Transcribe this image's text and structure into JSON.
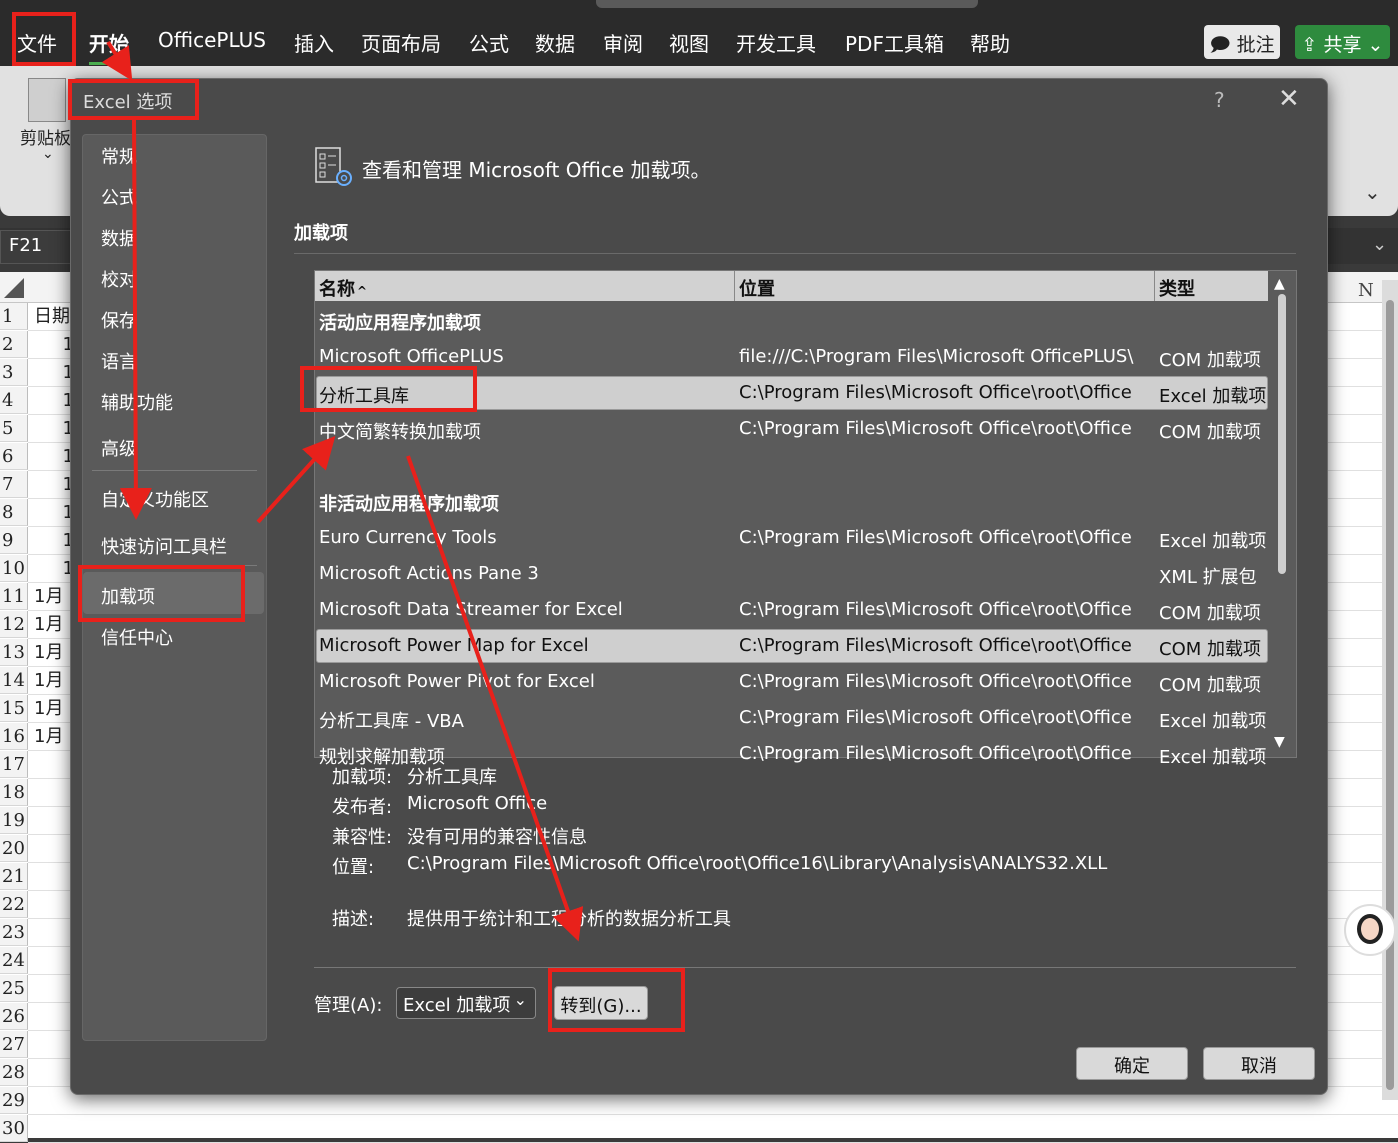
{
  "menu": {
    "items": [
      "文件",
      "开始",
      "OfficePLUS",
      "插入",
      "页面布局",
      "公式",
      "数据",
      "审阅",
      "视图",
      "开发工具",
      "PDF工具箱",
      "帮助"
    ],
    "active_index": 1,
    "comment_label": "批注",
    "share_label": "共享"
  },
  "ribbon": {
    "clipboard_label": "剪贴板"
  },
  "namebox": "F21",
  "sheet": {
    "row_numbers": [
      "1",
      "2",
      "3",
      "4",
      "5",
      "6",
      "7",
      "8",
      "9",
      "10",
      "11",
      "12",
      "13",
      "14",
      "15",
      "16",
      "17",
      "18",
      "19",
      "20",
      "21",
      "22",
      "23",
      "24",
      "25",
      "26",
      "27",
      "28",
      "29",
      "30"
    ],
    "col_a": [
      "日期",
      "1",
      "1",
      "1",
      "1",
      "1",
      "1",
      "1",
      "1",
      "1",
      "1月",
      "1月",
      "1月",
      "1月",
      "1月",
      "1月",
      "",
      "",
      "",
      "",
      "",
      "",
      "",
      "",
      "",
      "",
      "",
      "",
      "",
      ""
    ],
    "col_n": "N"
  },
  "dialog": {
    "title": "Excel 选项",
    "help": "?",
    "close": "✕",
    "nav": [
      "常规",
      "公式",
      "数据",
      "校对",
      "保存",
      "语言",
      "辅助功能",
      "高级",
      "自定义功能区",
      "快速访问工具栏",
      "加载项",
      "信任中心"
    ],
    "nav_selected": "加载项",
    "header_text": "查看和管理 Microsoft Office 加载项。",
    "section_label": "加载项",
    "table": {
      "columns": [
        "名称",
        "位置",
        "类型"
      ],
      "sort_marker": "^",
      "active_group": "活动应用程序加载项",
      "active_rows": [
        {
          "name": "Microsoft OfficePLUS",
          "location": "file:///C:\\Program Files\\Microsoft OfficePLUS\\",
          "type": "COM 加载项"
        },
        {
          "name": "分析工具库",
          "location": "C:\\Program Files\\Microsoft Office\\root\\Office",
          "type": "Excel 加载项"
        },
        {
          "name": "中文简繁转换加载项",
          "location": "C:\\Program Files\\Microsoft Office\\root\\Office",
          "type": "COM 加载项"
        }
      ],
      "inactive_group": "非活动应用程序加载项",
      "inactive_rows": [
        {
          "name": "Euro Currency Tools",
          "location": "C:\\Program Files\\Microsoft Office\\root\\Office",
          "type": "Excel 加载项"
        },
        {
          "name": "Microsoft Actions Pane 3",
          "location": "",
          "type": "XML 扩展包"
        },
        {
          "name": "Microsoft Data Streamer for Excel",
          "location": "C:\\Program Files\\Microsoft Office\\root\\Office",
          "type": "COM 加载项"
        },
        {
          "name": "Microsoft Power Map for Excel",
          "location": "C:\\Program Files\\Microsoft Office\\root\\Office",
          "type": "COM 加载项"
        },
        {
          "name": "Microsoft Power Pivot for Excel",
          "location": "C:\\Program Files\\Microsoft Office\\root\\Office",
          "type": "COM 加载项"
        },
        {
          "name": "分析工具库 - VBA",
          "location": "C:\\Program Files\\Microsoft Office\\root\\Office",
          "type": "Excel 加载项"
        },
        {
          "name": "规划求解加载项",
          "location": "C:\\Program Files\\Microsoft Office\\root\\Office",
          "type": "Excel 加载项"
        }
      ]
    },
    "details": {
      "addin_label": "加载项:",
      "addin_value": "分析工具库",
      "publisher_label": "发布者:",
      "publisher_value": "Microsoft Office",
      "compat_label": "兼容性:",
      "compat_value": "没有可用的兼容性信息",
      "location_label": "位置:",
      "location_value": "C:\\Program Files\\Microsoft Office\\root\\Office16\\Library\\Analysis\\ANALYS32.XLL",
      "desc_label": "描述:",
      "desc_value": "提供用于统计和工程分析的数据分析工具"
    },
    "manage_label": "管理(A):",
    "manage_value": "Excel 加载项",
    "goto_label": "转到(G)...",
    "ok_label": "确定",
    "cancel_label": "取消"
  },
  "annotation_color": "#e8211b"
}
